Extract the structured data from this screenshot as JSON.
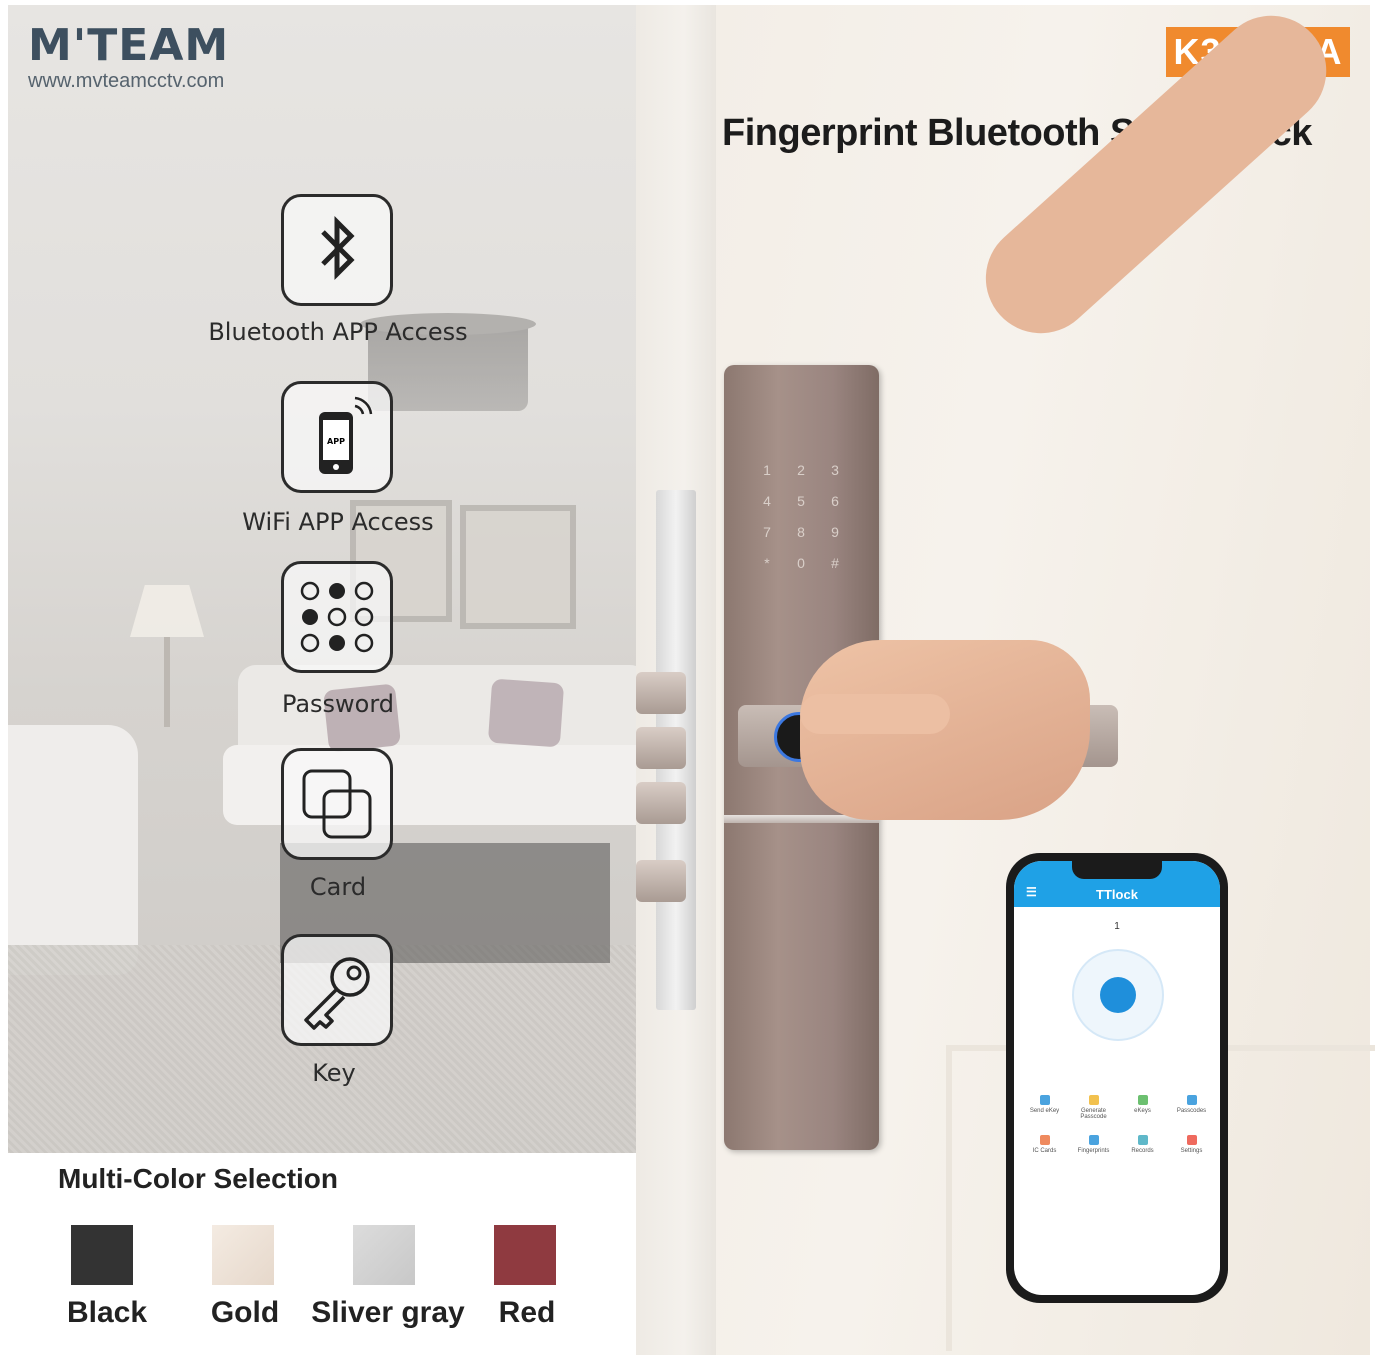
{
  "brand": {
    "logo": "M'TEAM",
    "url": "www.mvteamcctv.com"
  },
  "model_badge": "K3-ZKMA",
  "headline": "Fingerprint Bluetooth Smart Lock",
  "features": [
    {
      "label": "Bluetooth APP Access",
      "icon": "bluetooth-icon"
    },
    {
      "label": "WiFi APP Access",
      "icon": "phone-wifi-icon"
    },
    {
      "label": "Password",
      "icon": "keypad-dots-icon"
    },
    {
      "label": "Card",
      "icon": "card-icon"
    },
    {
      "label": "Key",
      "icon": "key-icon"
    }
  ],
  "color_selection": {
    "title": "Multi-Color Selection",
    "options": [
      {
        "label": "Black",
        "color": "#333333"
      },
      {
        "label": "Gold",
        "color": "#efe4da"
      },
      {
        "label": "Sliver gray",
        "color": "#d3d3d3"
      },
      {
        "label": "Red",
        "color": "#8f3a40"
      }
    ]
  },
  "keypad": [
    "1",
    "2",
    "3",
    "4",
    "5",
    "6",
    "7",
    "8",
    "9",
    "*",
    "0",
    "#"
  ],
  "phone_app": {
    "title": "TTlock",
    "lock_number": "1",
    "buttons": [
      "Send eKey",
      "Generate Passcode",
      "eKeys",
      "Passcodes",
      "IC Cards",
      "Fingerprints",
      "Records",
      "Settings"
    ]
  },
  "colors": {
    "accent": "#f08a2e",
    "app_blue": "#1fa1e6"
  }
}
